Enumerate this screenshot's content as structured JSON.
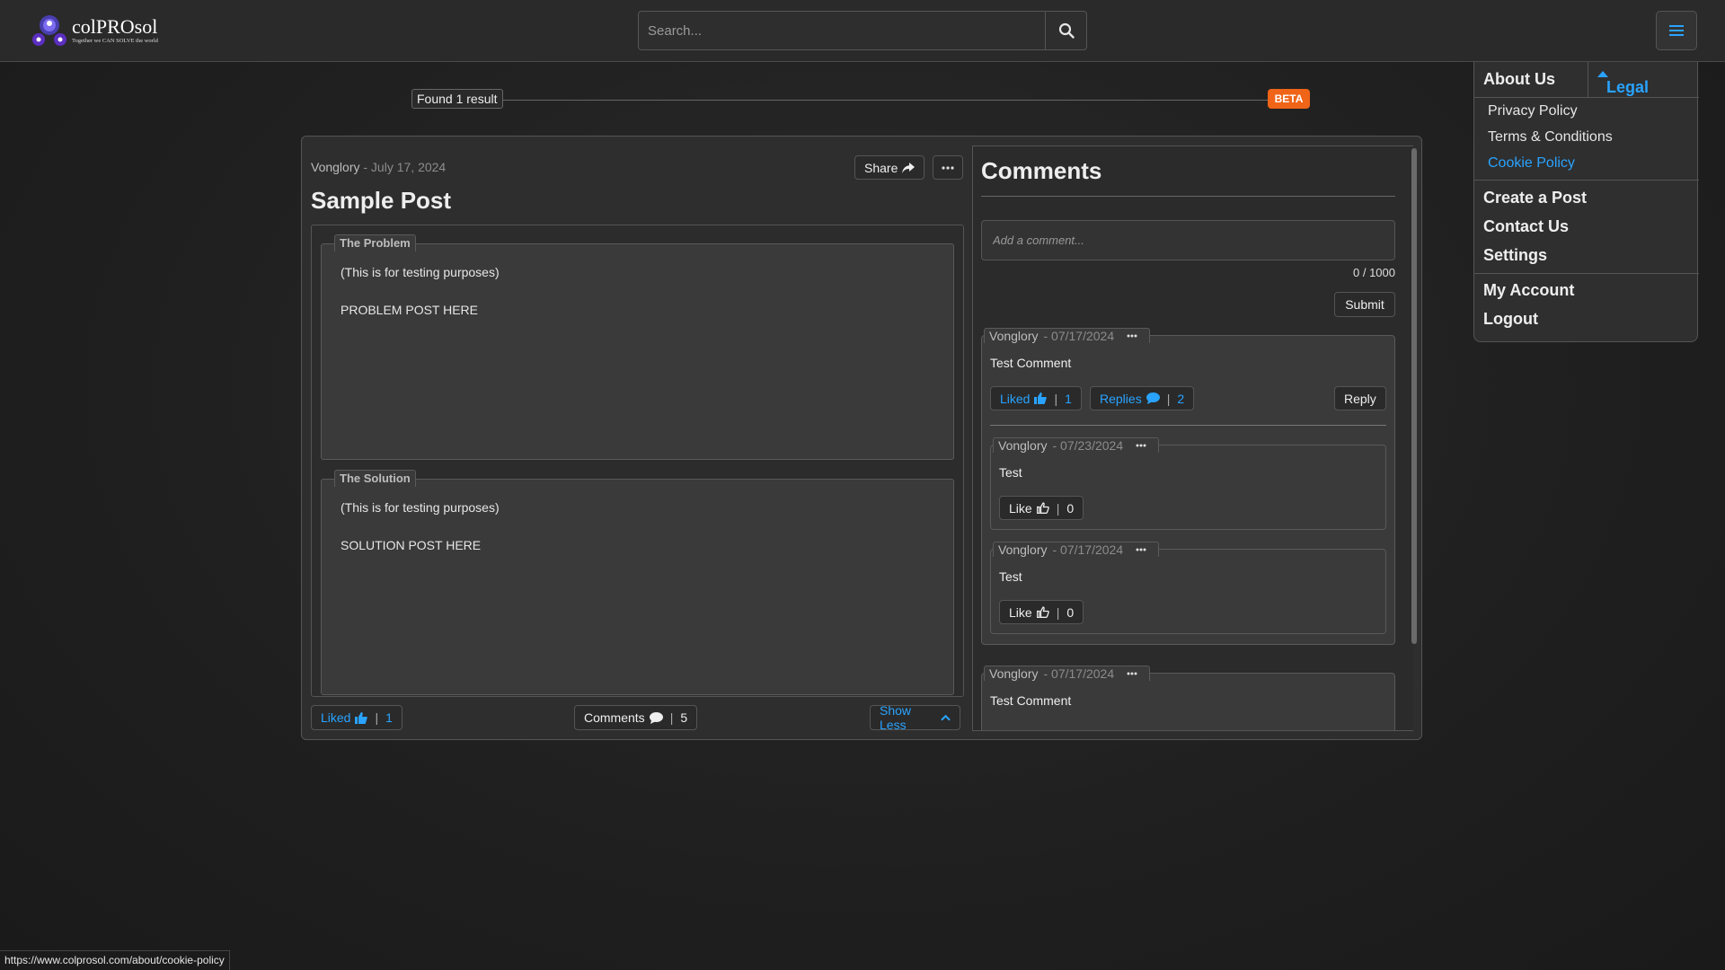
{
  "brand": {
    "name": "colPROsol",
    "tagline": "Together we CAN SOLVE the world"
  },
  "search": {
    "placeholder": "Search..."
  },
  "results": {
    "found_label": "Found 1 result",
    "beta_label": "BETA"
  },
  "post": {
    "author": "Vonglory",
    "date": "- July 17, 2024",
    "share_label": "Share",
    "title": "Sample Post",
    "problem": {
      "legend": "The Problem",
      "line1": "(This is for testing purposes)",
      "line2": "PROBLEM POST HERE"
    },
    "solution": {
      "legend": "The Solution",
      "line1": "(This is for testing purposes)",
      "line2": "SOLUTION POST HERE"
    },
    "liked_label": "Liked",
    "liked_sep": "|",
    "liked_count": "1",
    "comments_label": "Comments",
    "comments_sep": "|",
    "comments_count": "5",
    "show_less_label": "Show Less"
  },
  "comments": {
    "title": "Comments",
    "input_placeholder": "Add a comment...",
    "char_count": "0 / 1000",
    "submit_label": "Submit",
    "items": [
      {
        "author": "Vonglory",
        "date": "- 07/17/2024",
        "text": "Test Comment",
        "liked_label": "Liked",
        "liked_sep": "|",
        "liked_count": "1",
        "replies_label": "Replies",
        "replies_sep": "|",
        "replies_count": "2",
        "reply_label": "Reply",
        "replies": [
          {
            "author": "Vonglory",
            "date": "- 07/23/2024",
            "text": "Test",
            "like_label": "Like",
            "like_sep": "|",
            "like_count": "0"
          },
          {
            "author": "Vonglory",
            "date": "- 07/17/2024",
            "text": "Test",
            "like_label": "Like",
            "like_sep": "|",
            "like_count": "0"
          }
        ]
      },
      {
        "author": "Vonglory",
        "date": "- 07/17/2024",
        "text": "Test Comment"
      }
    ]
  },
  "menu": {
    "about_label": "About Us",
    "legal_label": "Legal",
    "legal_items": [
      "Privacy Policy",
      "Terms & Conditions",
      "Cookie Policy"
    ],
    "main_items": [
      "Create a Post",
      "Contact Us",
      "Settings"
    ],
    "account_items": [
      "My Account",
      "Logout"
    ]
  },
  "status_url": "https://www.colprosol.com/about/cookie-policy",
  "colors": {
    "accent": "#29a3ff",
    "beta": "#f06418",
    "background": "#1f1f1f"
  }
}
